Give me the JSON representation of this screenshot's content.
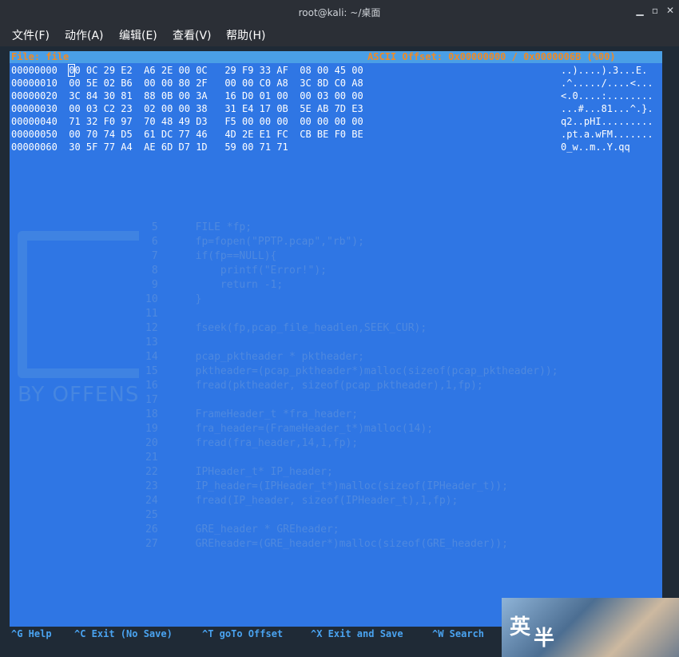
{
  "window": {
    "title": "root@kali: ~/桌面"
  },
  "menu": [
    "文件(F)",
    "动作(A)",
    "编辑(E)",
    "查看(V)",
    "帮助(H)"
  ],
  "editor": {
    "file_label": "File: file",
    "offset_label": "ASCII Offset: 0x00000000 / 0x0000006B (%00)",
    "cursor_char": "0",
    "rows": [
      {
        "offset": "00000000",
        "hex": "00 0C 29 E2  A6 2E 00 0C   29 F9 33 AF  08 00 45 00",
        "ascii": "..)....).3...E."
      },
      {
        "offset": "00000010",
        "hex": "00 5E 02 B6  00 00 80 2F   00 00 C0 A8  3C 8D C0 A8",
        "ascii": ".^...../....<..."
      },
      {
        "offset": "00000020",
        "hex": "3C 84 30 81  88 0B 00 3A   16 D0 01 00  00 03 00 00",
        "ascii": "<.0....:........"
      },
      {
        "offset": "00000030",
        "hex": "00 03 C2 23  02 00 00 38   31 E4 17 0B  5E AB 7D E3",
        "ascii": "...#...81...^.}."
      },
      {
        "offset": "00000040",
        "hex": "71 32 F0 97  70 48 49 D3   F5 00 00 00  00 00 00 00",
        "ascii": "q2..pHI........."
      },
      {
        "offset": "00000050",
        "hex": "00 70 74 D5  61 DC 77 46   4D 2E E1 FC  CB BE F0 BE",
        "ascii": ".pt.a.wFM......."
      },
      {
        "offset": "00000060",
        "hex": "30 5F 77 A4  AE 6D D7 1D   59 00 71 71",
        "ascii": "0_w..m..Y.qq"
      }
    ]
  },
  "background_code": [
    "",
    "",
    "",
    "",
    " 5      FILE *fp;",
    " 6      fp=fopen(\"PPTP.pcap\",\"rb\");",
    " 7      if(fp==NULL){",
    " 8          printf(\"Error!\");",
    " 9          return -1;",
    "10      }",
    "11",
    "12      fseek(fp,pcap_file_headlen,SEEK_CUR);",
    "13",
    "14      pcap_pktheader * pktheader;",
    "15      pktheader=(pcap_pktheader*)malloc(sizeof(pcap_pktheader));",
    "16      fread(pktheader, sizeof(pcap_pktheader),1,fp);",
    "17",
    "18      FrameHeader_t *fra_header;",
    "19      fra_header=(FrameHeader_t*)malloc(14);",
    "20      fread(fra_header,14,1,fp);",
    "21",
    "22      IPHeader_t* IP_header;",
    "23      IP_header=(IPHeader_t*)malloc(sizeof(IPHeader_t));",
    "24      fread(IP_header, sizeof(IPHeader_t),1,fp);",
    "25",
    "26      GRE_header * GREheader;",
    "27      GREheader=(GRE_header*)malloc(sizeof(GRE_header));"
  ],
  "background_brand": "BY OFFENS",
  "help_keys": [
    "^G Help",
    "^C Exit (No Save)",
    "^T goTo Offset",
    "^X Exit and Save",
    "^W Search"
  ],
  "ime": {
    "key1": "英",
    "key2": "半"
  },
  "colors": {
    "terminal_bg": "#2f76e4",
    "status_bar": "#4a9fe6",
    "status_text": "#f08a24",
    "help_text": "#4aa3f0"
  }
}
